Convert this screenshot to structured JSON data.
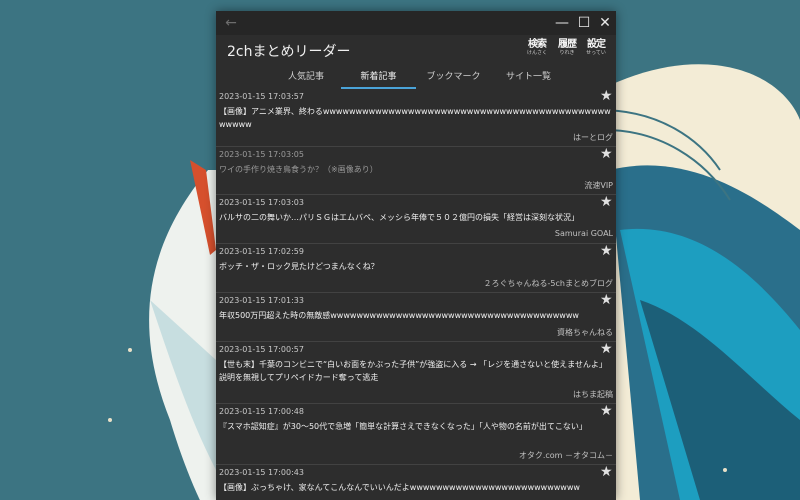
{
  "colors": {
    "accent": "#4aa3d8",
    "window_bg": "#2d2d2d",
    "titlebar_bg": "#262626",
    "wallpaper": "#3c7482"
  },
  "window": {
    "back_icon": "arrow-left-icon",
    "minimize_icon": "minimize-icon",
    "maximize_icon": "maximize-icon",
    "close_icon": "close-icon"
  },
  "app": {
    "title": "2chまとめリーダー",
    "actions": [
      {
        "name": "search",
        "kanji": "検索",
        "ruby": "けんさく"
      },
      {
        "name": "history",
        "kanji": "履歴",
        "ruby": "りれき"
      },
      {
        "name": "settings",
        "kanji": "設定",
        "ruby": "せってい"
      }
    ]
  },
  "tabs": [
    {
      "label": "人気記事"
    },
    {
      "label": "新着記事",
      "selected": true
    },
    {
      "label": "ブックマーク"
    },
    {
      "label": "サイト一覧"
    }
  ],
  "articles": [
    {
      "time": "2023-01-15 17:03:57",
      "title": "【画像】アニメ業界、終わるwwwwwwwwwwwwwwwwwwwwwwwwwwwwwwwwwwwwwwwwwwwwwwwww",
      "source": "はーとログ",
      "read": false
    },
    {
      "time": "2023-01-15 17:03:05",
      "title": "ワイの手作り焼き鳥食うか？（※画像あり）",
      "source": "流速VIP",
      "read": true
    },
    {
      "time": "2023-01-15 17:03:03",
      "title": "バルサの二の舞いか…パリＳＧはエムバペ、メッシら年俸で５０２億円の損失「経営は深刻な状況」",
      "source": "Samurai GOAL",
      "read": false
    },
    {
      "time": "2023-01-15 17:02:59",
      "title": "ボッチ・ザ・ロック見たけどつまんなくね？",
      "source": "２ろぐちゃんねる-5chまとめブログ",
      "read": false
    },
    {
      "time": "2023-01-15 17:01:33",
      "title": "年収500万円超えた時の無敵感wwwwwwwwwwwwwwwwwwwwwwwwwwwwwwwwwwwwww",
      "source": "資格ちゃんねる",
      "read": false
    },
    {
      "time": "2023-01-15 17:00:57",
      "title": "【世も末】千葉のコンビニで“白いお面をかぶった子供”が強盗に入る → 「レジを通さないと使えませんよ」説明を無視してプリペイドカード奪って逃走",
      "source": "はちま起稿",
      "read": false
    },
    {
      "time": "2023-01-15 17:00:48",
      "title": "『スマホ認知症』が30〜50代で急増「簡単な計算さえできなくなった」「人や物の名前が出てこない」",
      "source": "オタク.com －オタコム－",
      "read": false
    },
    {
      "time": "2023-01-15 17:00:43",
      "title": "【画像】ぶっちゃけ、家なんてこんなんでいいんだよwwwwwwwwwwwwwwwwwwwwwwwwww",
      "source": "",
      "read": false
    }
  ]
}
